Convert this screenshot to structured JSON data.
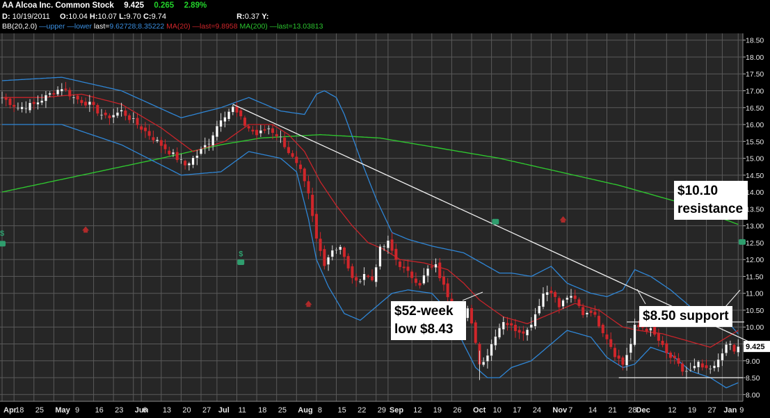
{
  "header": {
    "ticker_name": "AA Alcoa Inc. Common Stock",
    "last": "9.425",
    "change": "0.265",
    "change_pct": "2.89%",
    "d_label": "D:",
    "d_value": "10/19/2011",
    "o_label": "O:",
    "o_value": "10.04",
    "h_label": "H:",
    "h_value": "10.07",
    "l_label": "L:",
    "l_value": "9.70",
    "c_label": "C:",
    "c_value": "9.74",
    "r_label": "R:",
    "r_value": "0.37",
    "y_label": "Y:",
    "bb_label": "BB(20,2.0)",
    "bb_upper": "upper",
    "bb_lower": "lower",
    "bb_last": "last=",
    "bb_last_values": "9.62728;8.35222",
    "mid_label": "MA(20)",
    "mid_last": "last=9.8958",
    "ma200_label": "MA(200)",
    "ma200_last": "last=13.03813"
  },
  "chart_data": {
    "type": "candlestick",
    "ylim": [
      7.8,
      18.7
    ],
    "y_ticks": [
      8.0,
      8.5,
      9.0,
      9.5,
      10.0,
      10.5,
      11.0,
      11.5,
      12.0,
      12.5,
      13.0,
      13.5,
      14.0,
      14.5,
      15.0,
      15.5,
      16.0,
      16.5,
      17.0,
      17.5,
      18.0,
      18.5
    ],
    "y_tick_labels": [
      "8.00",
      "8.50",
      "9.00",
      "9.50",
      "10.00",
      "10.50",
      "11.00",
      "11.50",
      "12.00",
      "12.50",
      "13.00",
      "13.50",
      "14.00",
      "14.50",
      "15.00",
      "15.50",
      "16.00",
      "16.50",
      "17.00",
      "17.50",
      "18.00",
      "18.50"
    ],
    "x_labels": [
      {
        "label": "Apr",
        "bold": true,
        "i": 0
      },
      {
        "label": "18",
        "i": 3
      },
      {
        "label": "25",
        "i": 8
      },
      {
        "label": "May",
        "bold": true,
        "i": 13
      },
      {
        "label": "9",
        "i": 18
      },
      {
        "label": "16",
        "i": 23
      },
      {
        "label": "23",
        "i": 28
      },
      {
        "label": "Jun",
        "bold": true,
        "i": 33
      },
      {
        "label": "6",
        "i": 35
      },
      {
        "label": "13",
        "i": 40
      },
      {
        "label": "20",
        "i": 45
      },
      {
        "label": "27",
        "i": 50
      },
      {
        "label": "Jul",
        "bold": true,
        "i": 54
      },
      {
        "label": "11",
        "i": 59
      },
      {
        "label": "18",
        "i": 64
      },
      {
        "label": "25",
        "i": 69
      },
      {
        "label": "Aug",
        "bold": true,
        "i": 74
      },
      {
        "label": "8",
        "i": 79
      },
      {
        "label": "15",
        "i": 84
      },
      {
        "label": "22",
        "i": 89
      },
      {
        "label": "29",
        "i": 94
      },
      {
        "label": "Sep",
        "bold": true,
        "i": 97
      },
      {
        "label": "12",
        "i": 103
      },
      {
        "label": "19",
        "i": 108
      },
      {
        "label": "26",
        "i": 113
      },
      {
        "label": "Oct",
        "bold": true,
        "i": 118
      },
      {
        "label": "10",
        "i": 123
      },
      {
        "label": "17",
        "i": 128
      },
      {
        "label": "24",
        "i": 133
      },
      {
        "label": "Nov",
        "bold": true,
        "i": 138
      },
      {
        "label": "7",
        "i": 142
      },
      {
        "label": "14",
        "i": 147
      },
      {
        "label": "21",
        "i": 152
      },
      {
        "label": "28",
        "i": 157
      },
      {
        "label": "Dec",
        "bold": true,
        "i": 159
      },
      {
        "label": "12",
        "i": 167
      },
      {
        "label": "19",
        "i": 172
      },
      {
        "label": "27",
        "i": 177
      },
      {
        "label": "Jan",
        "bold": true,
        "i": 181
      },
      {
        "label": "9",
        "i": 185
      }
    ],
    "last_price_label": "9.425",
    "last_price": 9.425,
    "price_anchors": [
      [
        0,
        16.8
      ],
      [
        4,
        16.5
      ],
      [
        8,
        16.6
      ],
      [
        12,
        16.9
      ],
      [
        15,
        17.1
      ],
      [
        18,
        16.8
      ],
      [
        22,
        16.6
      ],
      [
        26,
        16.2
      ],
      [
        30,
        16.4
      ],
      [
        34,
        16.0
      ],
      [
        38,
        15.6
      ],
      [
        42,
        15.2
      ],
      [
        46,
        14.8
      ],
      [
        49,
        15.1
      ],
      [
        52,
        15.5
      ],
      [
        55,
        16.2
      ],
      [
        58,
        16.5
      ],
      [
        61,
        16.0
      ],
      [
        64,
        15.7
      ],
      [
        67,
        15.9
      ],
      [
        70,
        15.6
      ],
      [
        72,
        15.2
      ],
      [
        75,
        14.6
      ],
      [
        77,
        13.9
      ],
      [
        79,
        12.6
      ],
      [
        81,
        11.9
      ],
      [
        83,
        12.3
      ],
      [
        85,
        12.4
      ],
      [
        87,
        11.7
      ],
      [
        89,
        11.3
      ],
      [
        91,
        11.6
      ],
      [
        93,
        11.4
      ],
      [
        95,
        12.3
      ],
      [
        97,
        12.5
      ],
      [
        99,
        12.0
      ],
      [
        101,
        11.7
      ],
      [
        103,
        11.5
      ],
      [
        105,
        11.3
      ],
      [
        107,
        11.7
      ],
      [
        109,
        11.8
      ],
      [
        111,
        11.2
      ],
      [
        113,
        10.7
      ],
      [
        115,
        10.1
      ],
      [
        117,
        10.5
      ],
      [
        119,
        9.6
      ],
      [
        120,
        8.9
      ],
      [
        122,
        9.2
      ],
      [
        124,
        9.8
      ],
      [
        126,
        10.2
      ],
      [
        128,
        10.0
      ],
      [
        130,
        9.9
      ],
      [
        132,
        9.9
      ],
      [
        134,
        10.4
      ],
      [
        136,
        11.0
      ],
      [
        138,
        11.1
      ],
      [
        140,
        10.6
      ],
      [
        142,
        10.9
      ],
      [
        144,
        10.8
      ],
      [
        146,
        10.4
      ],
      [
        148,
        10.5
      ],
      [
        150,
        10.1
      ],
      [
        152,
        9.7
      ],
      [
        154,
        9.2
      ],
      [
        156,
        8.9
      ],
      [
        158,
        9.5
      ],
      [
        159,
        10.0
      ],
      [
        161,
        10.0
      ],
      [
        163,
        9.9
      ],
      [
        165,
        9.6
      ],
      [
        167,
        9.2
      ],
      [
        169,
        9.0
      ],
      [
        171,
        8.7
      ],
      [
        173,
        8.7
      ],
      [
        175,
        8.9
      ],
      [
        177,
        8.7
      ],
      [
        179,
        8.8
      ],
      [
        181,
        9.3
      ],
      [
        183,
        9.5
      ],
      [
        184,
        9.25
      ],
      [
        185,
        9.425
      ]
    ],
    "bollinger": {
      "upper": [
        [
          0,
          17.3
        ],
        [
          15,
          17.4
        ],
        [
          30,
          17.0
        ],
        [
          45,
          16.2
        ],
        [
          55,
          16.5
        ],
        [
          62,
          16.8
        ],
        [
          70,
          16.4
        ],
        [
          76,
          16.3
        ],
        [
          79,
          16.9
        ],
        [
          81,
          17.0
        ],
        [
          84,
          16.8
        ],
        [
          86,
          16.3
        ],
        [
          90,
          15.0
        ],
        [
          94,
          13.8
        ],
        [
          98,
          12.8
        ],
        [
          102,
          12.6
        ],
        [
          108,
          12.4
        ],
        [
          112,
          12.3
        ],
        [
          116,
          12.2
        ],
        [
          119,
          12.0
        ],
        [
          122,
          11.8
        ],
        [
          125,
          11.6
        ],
        [
          128,
          11.6
        ],
        [
          133,
          11.5
        ],
        [
          138,
          11.8
        ],
        [
          142,
          11.3
        ],
        [
          148,
          11.0
        ],
        [
          152,
          10.9
        ],
        [
          156,
          11.1
        ],
        [
          159,
          11.7
        ],
        [
          163,
          11.5
        ],
        [
          168,
          11.1
        ],
        [
          173,
          10.6
        ],
        [
          178,
          10.3
        ],
        [
          182,
          10.2
        ],
        [
          185,
          9.8
        ]
      ],
      "lower": [
        [
          0,
          16.0
        ],
        [
          15,
          16.0
        ],
        [
          30,
          15.4
        ],
        [
          45,
          14.5
        ],
        [
          55,
          14.6
        ],
        [
          62,
          15.2
        ],
        [
          70,
          15.0
        ],
        [
          74,
          14.6
        ],
        [
          77,
          13.2
        ],
        [
          79,
          12.0
        ],
        [
          82,
          11.2
        ],
        [
          86,
          10.4
        ],
        [
          90,
          10.2
        ],
        [
          94,
          10.6
        ],
        [
          98,
          11.0
        ],
        [
          102,
          11.1
        ],
        [
          108,
          11.0
        ],
        [
          112,
          10.5
        ],
        [
          116,
          9.5
        ],
        [
          119,
          8.8
        ],
        [
          122,
          8.5
        ],
        [
          125,
          8.5
        ],
        [
          128,
          8.8
        ],
        [
          133,
          9.0
        ],
        [
          138,
          9.5
        ],
        [
          142,
          9.9
        ],
        [
          148,
          9.7
        ],
        [
          152,
          9.1
        ],
        [
          156,
          8.8
        ],
        [
          159,
          8.9
        ],
        [
          163,
          9.4
        ],
        [
          168,
          9.2
        ],
        [
          173,
          8.7
        ],
        [
          178,
          8.5
        ],
        [
          182,
          8.2
        ],
        [
          185,
          8.35
        ]
      ]
    },
    "ma20": [
      [
        0,
        16.8
      ],
      [
        10,
        16.8
      ],
      [
        20,
        16.9
      ],
      [
        30,
        16.6
      ],
      [
        40,
        15.9
      ],
      [
        48,
        15.2
      ],
      [
        56,
        15.5
      ],
      [
        62,
        16.0
      ],
      [
        68,
        16.0
      ],
      [
        72,
        15.7
      ],
      [
        76,
        15.2
      ],
      [
        80,
        14.3
      ],
      [
        84,
        13.6
      ],
      [
        88,
        13.0
      ],
      [
        92,
        12.5
      ],
      [
        96,
        12.3
      ],
      [
        100,
        12.0
      ],
      [
        106,
        11.9
      ],
      [
        112,
        11.7
      ],
      [
        116,
        11.3
      ],
      [
        120,
        10.8
      ],
      [
        126,
        10.3
      ],
      [
        132,
        10.1
      ],
      [
        138,
        10.4
      ],
      [
        144,
        10.7
      ],
      [
        150,
        10.5
      ],
      [
        156,
        10.0
      ],
      [
        160,
        9.9
      ],
      [
        166,
        9.8
      ],
      [
        172,
        9.6
      ],
      [
        178,
        9.4
      ],
      [
        185,
        9.9
      ]
    ],
    "ma200": [
      [
        0,
        14.0
      ],
      [
        20,
        14.5
      ],
      [
        40,
        15.0
      ],
      [
        55,
        15.4
      ],
      [
        65,
        15.6
      ],
      [
        80,
        15.7
      ],
      [
        95,
        15.6
      ],
      [
        110,
        15.3
      ],
      [
        125,
        15.0
      ],
      [
        140,
        14.6
      ],
      [
        155,
        14.2
      ],
      [
        170,
        13.7
      ],
      [
        185,
        13.04
      ]
    ],
    "trendline": [
      [
        58,
        16.6
      ],
      [
        188,
        9.55
      ]
    ],
    "resistance": {
      "value": 10.15,
      "from": 157,
      "to": 188
    },
    "support": {
      "value": 8.5,
      "from": 155,
      "to": 188
    },
    "annotations": {
      "resistance": "$10.10\nresistance",
      "support": "$8.50 support",
      "low": "$52-week\nlow $8.43"
    },
    "markers": {
      "dollar": [
        [
          0,
          12.7
        ],
        [
          60,
          12.1
        ]
      ],
      "phone": [
        [
          0,
          12.45
        ],
        [
          60,
          11.9
        ],
        [
          124,
          13.1
        ],
        [
          186,
          12.5
        ]
      ],
      "arrow": [
        [
          21,
          12.9
        ],
        [
          77,
          10.7
        ],
        [
          141,
          13.2
        ]
      ]
    }
  }
}
